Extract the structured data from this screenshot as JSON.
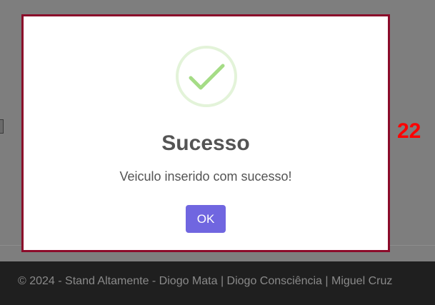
{
  "modal": {
    "icon": "success-check-icon",
    "title": "Sucesso",
    "message": "Veiculo inserido com sucesso!",
    "confirm_label": "OK",
    "accent_color": "#7066e0",
    "icon_color": "#a5dc86"
  },
  "side_number": "22",
  "footer": {
    "text": "© 2024 - Stand Altamente - Diogo Mata | Diogo Consciência | Miguel Cruz"
  }
}
